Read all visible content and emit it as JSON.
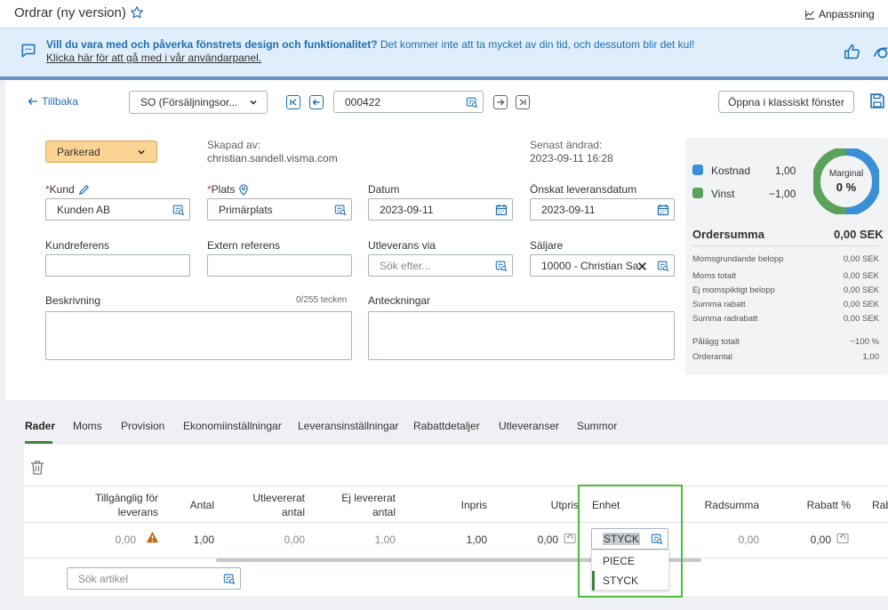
{
  "header": {
    "title": "Ordrar (ny version)",
    "customize_label": "Anpassning"
  },
  "banner": {
    "bold_text": "Vill du vara med och påverka fönstrets design och funktionalitet?",
    "text": " Det kommer inte att ta mycket av din tid, och dessutom blir det kul!",
    "link": "Klicka här för att gå med i vår användarpanel."
  },
  "toolbar": {
    "back_label": "Tillbaka",
    "order_type": "SO (Försäljningsor...",
    "order_number": "000422",
    "classic_button": "Öppna i klassiskt fönster"
  },
  "form": {
    "status": "Parkerad",
    "created_label": "Skapad av:",
    "created_value": "christian.sandell.visma.com",
    "changed_label": "Senast ändrad:",
    "changed_value": "2023-09-11 16:28",
    "customer_label": "Kund",
    "customer_value": "Kunden AB",
    "location_label": "Plats",
    "location_value": "Primärplats",
    "date_label": "Datum",
    "date_value": "2023-09-11",
    "requested_label": "Önskat leveransdatum",
    "requested_value": "2023-09-11",
    "customer_ref_label": "Kundreferens",
    "external_ref_label": "Extern referens",
    "ship_via_label": "Utleverans via",
    "ship_via_placeholder": "Sök efter...",
    "seller_label": "Säljare",
    "seller_value": "10000 - Christian Sa",
    "description_label": "Beskrivning",
    "description_counter": "0/255 tecken",
    "notes_label": "Anteckningar"
  },
  "summary": {
    "donut_label": "Marginal",
    "donut_value": "0 %",
    "cost_label": "Kostnad",
    "cost_value": "1,00",
    "profit_label": "Vinst",
    "profit_value": "−1,00",
    "total_label": "Ordersumma",
    "total_value": "0,00 SEK",
    "rows": [
      {
        "label": "Momsgrundande belopp",
        "value": "0,00 SEK"
      },
      {
        "label": "Moms totalt",
        "value": "0,00 SEK"
      },
      {
        "label": "Ej momspiktigt belopp",
        "value": "0,00 SEK"
      },
      {
        "label": "Summa rabatt",
        "value": "0,00 SEK"
      },
      {
        "label": "Summa radrabatt",
        "value": "0,00 SEK"
      },
      {
        "label": "Pålägg totalt",
        "value": "−100 %"
      },
      {
        "label": "Orderantal",
        "value": "1,00"
      }
    ],
    "cost_color": "#3a8fd6",
    "profit_color": "#5aa15a"
  },
  "tabs": [
    "Rader",
    "Moms",
    "Provision",
    "Ekonomiinställningar",
    "Leveransinställningar",
    "Rabattdetaljer",
    "Utleveranser",
    "Summor"
  ],
  "grid": {
    "columns": {
      "available_1": "Tillgänglig för",
      "available_2": "leverans",
      "qty": "Antal",
      "shipped_1": "Utlevererat",
      "shipped_2": "antal",
      "not_shipped_1": "Ej levererat",
      "not_shipped_2": "antal",
      "unit_cost": "Inpris",
      "unit_price": "Utpris",
      "unit": "Enhet",
      "row_total": "Radsumma",
      "discount": "Rabatt %",
      "discount_amt": "Rab"
    },
    "row": {
      "available": "0,00",
      "qty": "1,00",
      "shipped": "0,00",
      "not_shipped": "1,00",
      "unit_cost": "1,00",
      "unit_price": "0,00",
      "unit": "STYCK",
      "row_total": "0,00",
      "discount": "0,00"
    },
    "search_placeholder": "Sök artikel",
    "unit_options": [
      "PIECE",
      "STYCK"
    ]
  }
}
